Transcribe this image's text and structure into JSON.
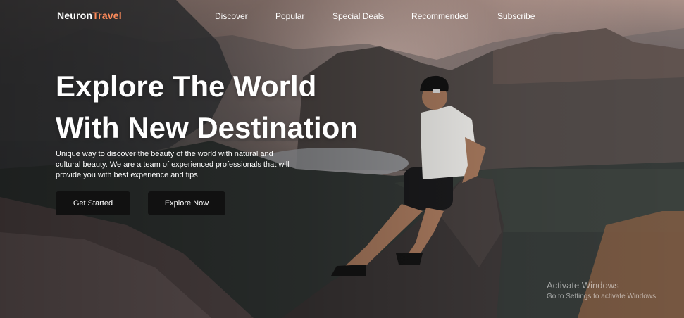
{
  "brand": {
    "name_part1": "Neuron",
    "name_part2": "Travel",
    "accent_color": "#ff8b5a"
  },
  "nav": {
    "items": [
      {
        "label": "Discover"
      },
      {
        "label": "Popular"
      },
      {
        "label": "Special Deals"
      },
      {
        "label": "Recommended"
      },
      {
        "label": "Subscribe"
      }
    ]
  },
  "hero": {
    "headline_line1": "Explore The World",
    "headline_line2": "With New Destination",
    "description": "Unique way to discover the beauty of the world with natural and cultural beauty. We are a team of experienced professionals that will provide you with best experience and tips",
    "primary_button": "Get Started",
    "secondary_button": "Explore Now",
    "background_image": "hiker-sitting-on-rock-mountain-canyon-photo"
  },
  "watermark": {
    "title": "Activate Windows",
    "subtitle": "Go to Settings to activate Windows."
  }
}
